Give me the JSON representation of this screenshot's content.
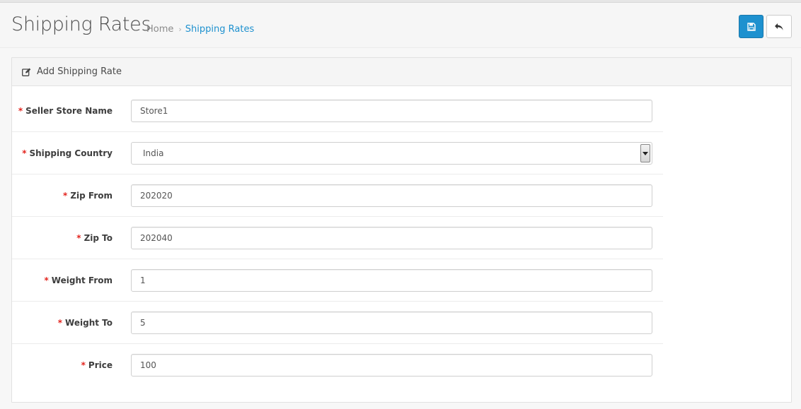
{
  "header": {
    "title": "Shipping Rates",
    "breadcrumb": [
      {
        "label": "Home"
      },
      {
        "label": "Shipping Rates"
      }
    ],
    "breadcrumb_separator": "›",
    "save_icon": "floppy-disk-icon",
    "back_icon": "reply-arrow-icon"
  },
  "panel": {
    "icon": "edit-pencil-icon",
    "title": "Add Shipping Rate"
  },
  "form": {
    "required_mark": "*",
    "fields": [
      {
        "label": "Seller Store Name",
        "value": "Store1"
      },
      {
        "label": "Shipping Country",
        "value": "India"
      },
      {
        "label": "Zip From",
        "value": "202020"
      },
      {
        "label": "Zip To",
        "value": "202040"
      },
      {
        "label": "Weight From",
        "value": "1"
      },
      {
        "label": "Weight To",
        "value": "5"
      },
      {
        "label": "Price",
        "value": "100"
      }
    ]
  },
  "colors": {
    "primary": "#1e91cf",
    "required": "#e3241e",
    "link": "#1e91cf"
  }
}
